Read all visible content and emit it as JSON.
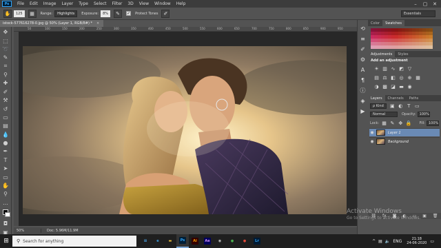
{
  "app": {
    "logo": "Ps",
    "menu": [
      "File",
      "Edit",
      "Image",
      "Layer",
      "Type",
      "Select",
      "Filter",
      "3D",
      "View",
      "Window",
      "Help"
    ],
    "window_controls": [
      "–",
      "▢",
      "✕"
    ]
  },
  "options_bar": {
    "brush_size": "125",
    "range_label": "Range:",
    "range_value": "Highlights",
    "exposure_label": "Exposure:",
    "exposure_value": "8%",
    "protect_tones_label": "Protect Tones",
    "protect_tones_checked": true,
    "workspace": "Essentials"
  },
  "document": {
    "tab_title": "istock-577616278-0.jpg @ 50% (Layer 1, RGB/8#) *",
    "close": "×",
    "ruler_ticks": [
      "50",
      "100",
      "150",
      "200",
      "250",
      "300",
      "350",
      "400",
      "450",
      "500",
      "550",
      "600",
      "650",
      "700",
      "750",
      "800",
      "850",
      "900",
      "950"
    ]
  },
  "status": {
    "zoom": "50%",
    "doc_info": "Doc: 5.96M/11.9M"
  },
  "panels": {
    "color_tabs": [
      "Color",
      "Swatches"
    ],
    "adjustments_tabs": [
      "Adjustments",
      "Styles"
    ],
    "adjustments_title": "Add an adjustment",
    "layers_tabs": [
      "Layers",
      "Channels",
      "Paths"
    ],
    "kind_filter": "ρ Kind",
    "blend_mode": "Normal",
    "opacity_label": "Opacity:",
    "opacity_value": "100%",
    "lock_label": "Lock:",
    "fill_label": "Fill:",
    "fill_value": "100%",
    "layers": [
      {
        "name": "Layer 1",
        "selected": true
      },
      {
        "name": "Background",
        "selected": false
      }
    ]
  },
  "watermark": {
    "title": "Activate Windows",
    "subtitle": "Go to Settings to activate Windows."
  },
  "taskbar": {
    "search_placeholder": "Search for anything",
    "apps": [
      {
        "glyph": "⊞",
        "color": "#4ea6ea",
        "bg": "transparent",
        "active": false
      },
      {
        "glyph": "e",
        "color": "#3ea0e6",
        "bg": "transparent",
        "active": false
      },
      {
        "glyph": "▬",
        "color": "#f2c33a",
        "bg": "transparent",
        "active": false
      },
      {
        "glyph": "Ps",
        "color": "#31a8ff",
        "bg": "#001e36",
        "active": true
      },
      {
        "glyph": "Ai",
        "color": "#ff9a00",
        "bg": "#330000",
        "active": false
      },
      {
        "glyph": "Ae",
        "color": "#d291ff",
        "bg": "#00005b",
        "active": false
      },
      {
        "glyph": "◉",
        "color": "#cccccc",
        "bg": "transparent",
        "active": false
      },
      {
        "glyph": "●",
        "color": "#4caf50",
        "bg": "transparent",
        "active": false
      },
      {
        "glyph": "●",
        "color": "#e04a3a",
        "bg": "transparent",
        "active": false
      },
      {
        "glyph": "Lr",
        "color": "#31a8ff",
        "bg": "#001a33",
        "active": false
      }
    ],
    "language": "ENG",
    "time": "21:18",
    "date": "24-06-2020"
  }
}
